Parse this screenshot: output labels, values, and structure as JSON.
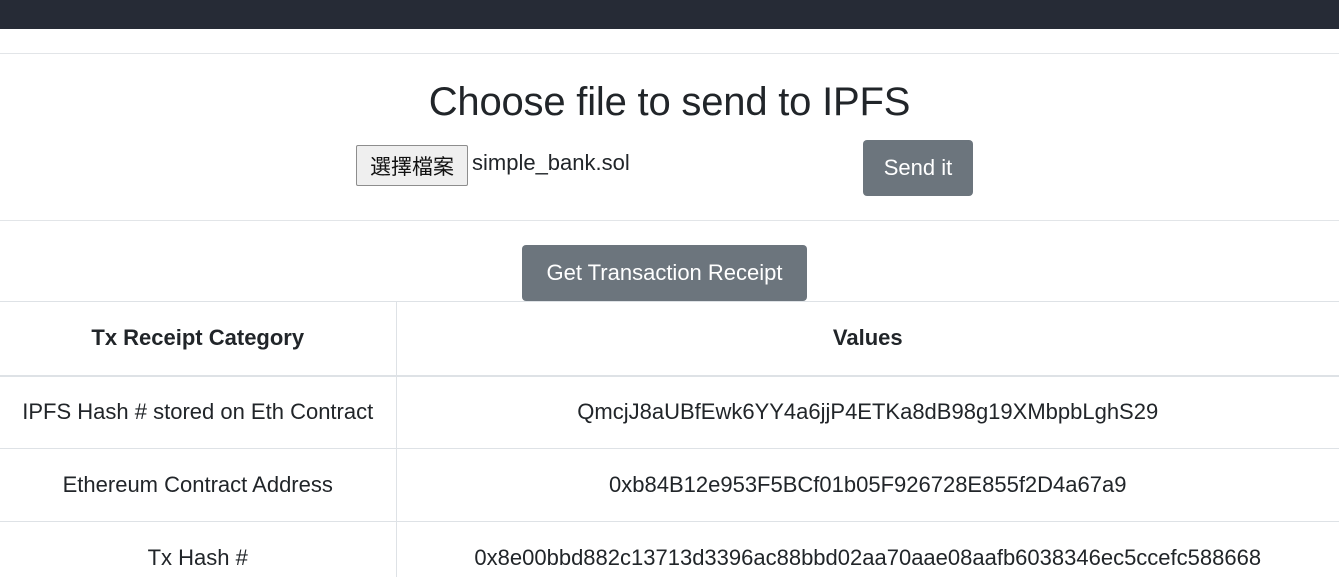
{
  "upload": {
    "title": "Choose file to send to IPFS",
    "file_button_label": "選擇檔案",
    "file_name": "simple_bank.sol",
    "send_label": "Send it"
  },
  "receipt": {
    "button_label": "Get Transaction Receipt",
    "headers": [
      "Tx Receipt Category",
      "Values"
    ],
    "rows": [
      {
        "category": "IPFS Hash # stored on Eth Contract",
        "value": "QmcjJ8aUBfEwk6YY4a6jjP4ETKa8dB98g19XMbpbLghS29"
      },
      {
        "category": "Ethereum Contract Address",
        "value": "0xb84B12e953F5BCf01b05F926728E855f2D4a67a9"
      },
      {
        "category": "Tx Hash #",
        "value": "0x8e00bbd882c13713d3396ac88bbd02aa70aae08aafb6038346ec5ccefc588668"
      }
    ]
  }
}
